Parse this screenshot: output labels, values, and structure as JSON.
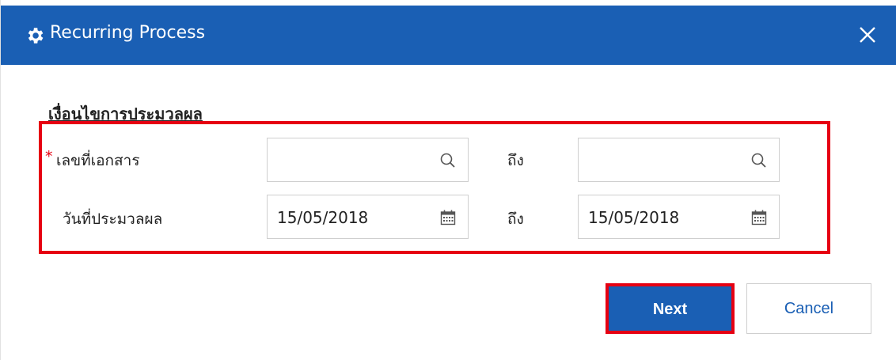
{
  "dialog": {
    "title": "Recurring Process",
    "title_icon": "gear-icon",
    "close_icon": "close-icon"
  },
  "criteria": {
    "heading": "เงื่อนไขการประมวลผล",
    "doc_no": {
      "required_mark": "*",
      "label": "เลขที่เอกสาร",
      "from_value": "",
      "to_label": "ถึง",
      "to_value": "",
      "icon": "search-icon"
    },
    "process_date": {
      "label": "วันที่ประมวลผล",
      "from_value": "15/05/2018",
      "to_label": "ถึง",
      "to_value": "15/05/2018",
      "icon": "calendar-icon"
    }
  },
  "buttons": {
    "next_label": "Next",
    "cancel_label": "Cancel"
  },
  "colors": {
    "header": "#1a5fb4",
    "highlight": "#e60012",
    "required": "#e60012"
  }
}
